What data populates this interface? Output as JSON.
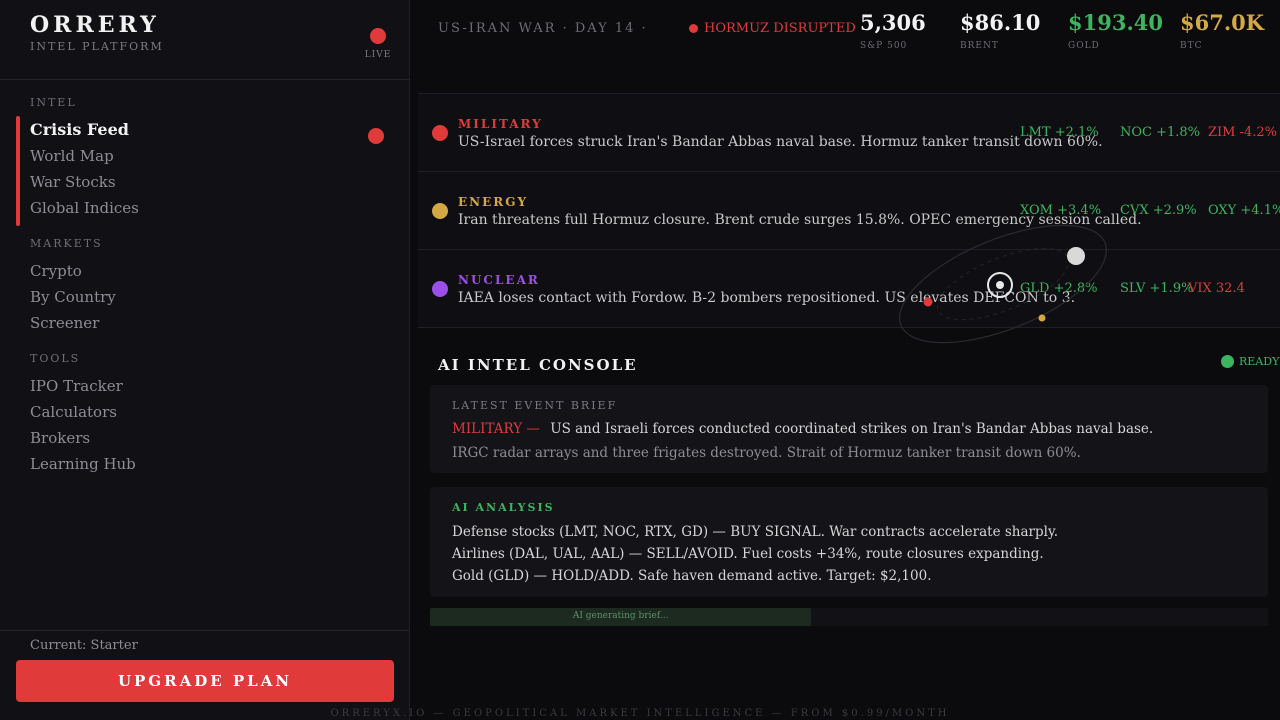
{
  "brand": {
    "title": "ORRERY",
    "subtitle": "INTEL PLATFORM",
    "live_label": "LIVE"
  },
  "nav": {
    "groups": [
      {
        "heading": "INTEL",
        "items": [
          "Crisis Feed",
          "World Map",
          "War Stocks",
          "Global Indices"
        ]
      },
      {
        "heading": "MARKETS",
        "items": [
          "Crypto",
          "By Country",
          "Screener"
        ]
      },
      {
        "heading": "TOOLS",
        "items": [
          "IPO Tracker",
          "Calculators",
          "Brokers",
          "Learning Hub"
        ]
      }
    ]
  },
  "plan": {
    "current": "Current: Starter",
    "upgrade_label": "UPGRADE PLAN"
  },
  "header": {
    "war_label": "US-IRAN WAR · DAY 14 ·",
    "alert": "HORMUZ DISRUPTED",
    "tickers": [
      {
        "value": "5,306",
        "label": "S&P 500",
        "color": "#f2f2f2"
      },
      {
        "value": "$86.10",
        "label": "BRENT",
        "color": "#f2f2f2"
      },
      {
        "value": "$193.40",
        "label": "GOLD",
        "color": "#3db560"
      },
      {
        "value": "$67.0K",
        "label": "BTC",
        "color": "#d4a845"
      }
    ]
  },
  "events": [
    {
      "category": "MILITARY",
      "color": "#e03a3a",
      "text": "US-Israel forces struck Iran's Bandar Abbas naval base. Hormuz tanker transit down 60%.",
      "stocks": [
        {
          "label": "LMT +2.1%",
          "color": "#3db560"
        },
        {
          "label": "NOC +1.8%",
          "color": "#3db560"
        },
        {
          "label": "ZIM -4.2%",
          "color": "#e03a3a"
        }
      ]
    },
    {
      "category": "ENERGY",
      "color": "#d4a845",
      "text": "Iran threatens full Hormuz closure. Brent crude surges 15.8%. OPEC emergency session called.",
      "stocks": [
        {
          "label": "XOM +3.4%",
          "color": "#3db560"
        },
        {
          "label": "CVX +2.9%",
          "color": "#3db560"
        },
        {
          "label": "OXY +4.1%",
          "color": "#3db560"
        }
      ]
    },
    {
      "category": "NUCLEAR",
      "color": "#9b4ee8",
      "text": "IAEA loses contact with Fordow. B-2 bombers repositioned. US elevates DEFCON to 3.",
      "stocks": [
        {
          "label": "GLD +2.8%",
          "color": "#3db560"
        },
        {
          "label": "SLV +1.9%",
          "color": "#3db560"
        },
        {
          "label": "VIX 32.4",
          "color": "#e03a3a"
        }
      ]
    }
  ],
  "console": {
    "title": "AI INTEL CONSOLE",
    "status": "READY",
    "brief": {
      "heading": "LATEST EVENT BRIEF",
      "tag": "MILITARY —",
      "line1": "US and Israeli forces conducted coordinated strikes on Iran's Bandar Abbas naval base.",
      "line2": "IRGC radar arrays and three frigates destroyed. Strait of Hormuz tanker transit down 60%."
    },
    "analysis": {
      "heading": "AI ANALYSIS",
      "lines": [
        "Defense stocks (LMT, NOC, RTX, GD) — BUY SIGNAL. War contracts accelerate sharply.",
        "Airlines (DAL, UAL, AAL) — SELL/AVOID. Fuel costs +34%, route closures expanding.",
        "Gold (GLD) — HOLD/ADD. Safe haven demand active. Target: $2,100."
      ]
    },
    "progress": {
      "label": "AI generating brief...",
      "fraction": 0.455
    }
  },
  "footer": "ORRERYX.IO — GEOPOLITICAL MARKET INTELLIGENCE — FROM $0.99/MONTH",
  "colors": {
    "accent": "#e03a3a",
    "success": "#3db560",
    "gold": "#d4a845",
    "nuclear": "#9b4ee8"
  }
}
